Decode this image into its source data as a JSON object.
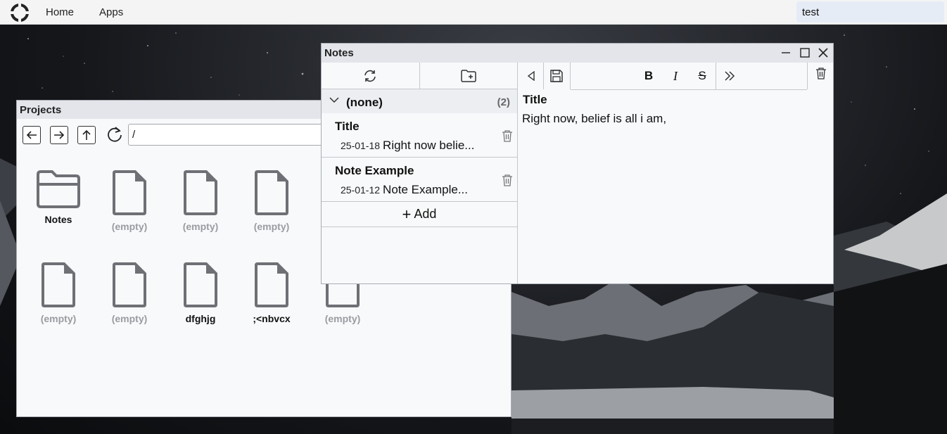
{
  "topbar": {
    "home_label": "Home",
    "apps_label": "Apps",
    "search_value": "test"
  },
  "projects_window": {
    "title": "Projects",
    "path_value": "/",
    "files": [
      {
        "label": "Notes",
        "kind": "folder",
        "muted": false
      },
      {
        "label": "(empty)",
        "kind": "file",
        "muted": true
      },
      {
        "label": "(empty)",
        "kind": "file",
        "muted": true
      },
      {
        "label": "(empty)",
        "kind": "file",
        "muted": true
      },
      {
        "label": "(empty)",
        "kind": "file",
        "muted": true
      },
      {
        "label": "(empty)",
        "kind": "file",
        "muted": true
      },
      {
        "label": "dfghjg",
        "kind": "file",
        "muted": false
      },
      {
        "label": ";<nbvcx",
        "kind": "file",
        "muted": false
      },
      {
        "label": "(empty)",
        "kind": "file",
        "muted": true
      }
    ]
  },
  "notes_window": {
    "title": "Notes",
    "group": {
      "name": "(none)",
      "count": "(2)"
    },
    "notes": [
      {
        "title": "Title",
        "date": "25-01-18",
        "preview": "Right now belie..."
      },
      {
        "title": "Note Example",
        "date": "25-01-12",
        "preview": "Note Example..."
      }
    ],
    "add_label": "Add",
    "editor": {
      "title": "Title",
      "body": "Right now, belief is all i am,",
      "bold_label": "B",
      "italic_label": "I",
      "strike_label": "S"
    }
  },
  "colors": {
    "topbar_bg": "#f4f4f5",
    "window_bg": "#f8f9fb",
    "titlebar_bg": "#e3e5ea",
    "search_bg": "#e6ecf6",
    "muted_text": "#9a9ca0"
  }
}
